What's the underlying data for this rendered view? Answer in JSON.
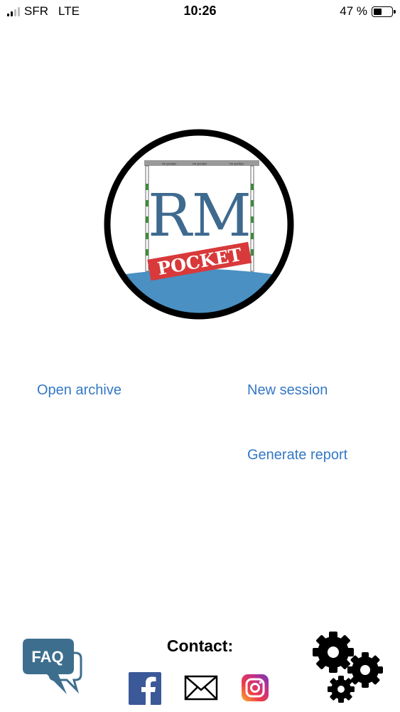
{
  "status_bar": {
    "carrier": "SFR",
    "network": "LTE",
    "time": "10:26",
    "battery_percent": "47 %",
    "battery_level": 0.47,
    "signal_bars": 2,
    "signal_bars_total": 4
  },
  "logo": {
    "main_text": "RM",
    "sub_text": "POCKET",
    "banner_text": "rm pocket",
    "colors": {
      "ring": "#000000",
      "rm_text": "#3f6a8f",
      "water": "#4a90c2",
      "pocket_banner": "#d8393a",
      "goal_post_stripe": "#3f8a3a"
    }
  },
  "actions": {
    "open_archive": "Open archive",
    "new_session": "New session",
    "generate_report": "Generate report",
    "link_color": "#3478c6"
  },
  "footer": {
    "contact_label": "Contact:",
    "faq_label": "FAQ",
    "icons": [
      "faq-icon",
      "facebook-icon",
      "mail-icon",
      "instagram-icon",
      "settings-gears-icon"
    ],
    "colors": {
      "faq": "#3e6e8e",
      "facebook": "#3b5998"
    }
  }
}
